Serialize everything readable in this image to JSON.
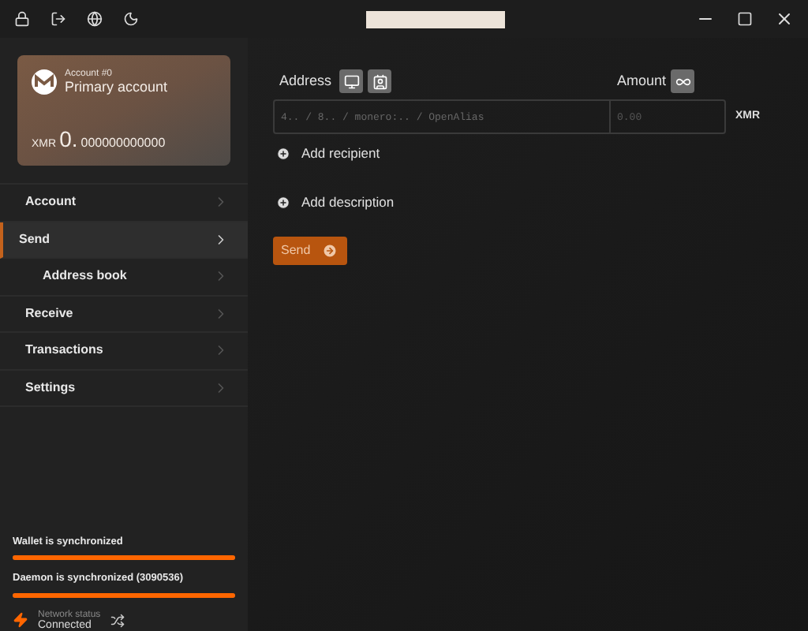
{
  "account": {
    "label": "Account #0",
    "name": "Primary account",
    "currency": "XMR",
    "balance_int": "0.",
    "balance_frac": "000000000000"
  },
  "nav": [
    {
      "label": "Account",
      "selected": false
    },
    {
      "label": "Send",
      "selected": true,
      "children": [
        {
          "label": "Address book",
          "selected": false
        }
      ]
    },
    {
      "label": "Receive",
      "selected": false
    },
    {
      "label": "Transactions",
      "selected": false
    },
    {
      "label": "Settings",
      "selected": false
    }
  ],
  "sync": [
    {
      "label": "Wallet is synchronized",
      "level": 1
    },
    {
      "label": "Daemon is synchronized (3090536)",
      "level": 1
    }
  ],
  "network": {
    "label": "Network status",
    "value": "Connected"
  },
  "form": {
    "address_label": "Address",
    "amount_label": "Amount",
    "address_placeholder": "4.. / 8.. / monero:.. / OpenAlias",
    "amount_placeholder": "0.00",
    "currency": "XMR",
    "add_recipient": "Add recipient",
    "add_description": "Add description",
    "send": "Send"
  }
}
